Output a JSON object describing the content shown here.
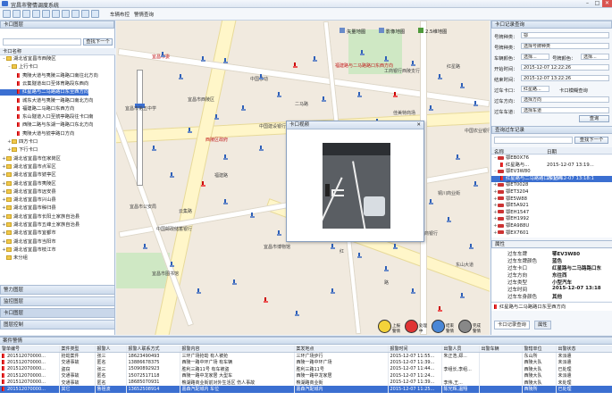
{
  "app": {
    "title": "宜昌市警情调度系统",
    "min": "–",
    "max": "□",
    "close": "✕"
  },
  "toolbar": {
    "vehicle_search": "车辆布控",
    "alarm_query": "警情查询"
  },
  "left_panel": {
    "title": "卡口图层",
    "search_label": "查找下一个",
    "col_header": "卡口名称",
    "tree": [
      {
        "t": "湖北省宜昌市西陵区",
        "lvl": 0,
        "k": "fold",
        "tog": "–"
      },
      {
        "t": "上行卡口",
        "lvl": 1,
        "k": "fold",
        "tog": "–"
      },
      {
        "t": "夷陵大道与夷陵三路路口南往北方向",
        "lvl": 2,
        "k": "flag"
      },
      {
        "t": "云集隧道出口至体育路段东西向",
        "lvl": 2,
        "k": "flag"
      },
      {
        "t": "红星路与二马路路口东至西方向",
        "lvl": 2,
        "k": "flag",
        "sel": true
      },
      {
        "t": "城东大道与夷陵一路路口南北方向",
        "lvl": 2,
        "k": "flag"
      },
      {
        "t": "福建路二马路口东西方向",
        "lvl": 2,
        "k": "flag"
      },
      {
        "t": "东山隧道入口至猇亭路段往卡口南",
        "lvl": 2,
        "k": "flag"
      },
      {
        "t": "西陵二路与东湖一路路口东北方向",
        "lvl": 2,
        "k": "flag"
      },
      {
        "t": "夷陵大道与猇亭路口方向",
        "lvl": 2,
        "k": "flag"
      },
      {
        "t": "四方卡口",
        "lvl": 1,
        "k": "fold",
        "tog": "+"
      },
      {
        "t": "下行卡口",
        "lvl": 1,
        "k": "fold",
        "tog": "+"
      },
      {
        "t": "湖北省宜昌市伍家岗区",
        "lvl": 0,
        "k": "fold",
        "tog": "+"
      },
      {
        "t": "湖北省宜昌市点军区",
        "lvl": 0,
        "k": "fold",
        "tog": "+"
      },
      {
        "t": "湖北省宜昌市猇亭区",
        "lvl": 0,
        "k": "fold",
        "tog": "+"
      },
      {
        "t": "湖北省宜昌市夷陵区",
        "lvl": 0,
        "k": "fold",
        "tog": "+"
      },
      {
        "t": "湖北省宜昌市远安县",
        "lvl": 0,
        "k": "fold",
        "tog": "+"
      },
      {
        "t": "湖北省宜昌市兴山县",
        "lvl": 0,
        "k": "fold",
        "tog": "+"
      },
      {
        "t": "湖北省宜昌市秭归县",
        "lvl": 0,
        "k": "fold",
        "tog": "+"
      },
      {
        "t": "湖北省宜昌市长阳土家族自治县",
        "lvl": 0,
        "k": "fold",
        "tog": "+"
      },
      {
        "t": "湖北省宜昌市五峰土家族自治县",
        "lvl": 0,
        "k": "fold",
        "tog": "+"
      },
      {
        "t": "湖北省宜昌市宜都市",
        "lvl": 0,
        "k": "fold",
        "tog": "+"
      },
      {
        "t": "湖北省宜昌市当阳市",
        "lvl": 0,
        "k": "fold",
        "tog": "+"
      },
      {
        "t": "湖北省宜昌市枝江市",
        "lvl": 0,
        "k": "fold",
        "tog": "+"
      },
      {
        "t": "未分组",
        "lvl": 0,
        "k": "fold",
        "tog": ""
      }
    ],
    "tabs": [
      "警力图层",
      "监控图层",
      "卡口图层",
      "图层控制"
    ]
  },
  "map": {
    "modes": [
      "矢量地图",
      "影像地图",
      "2.5维地图"
    ],
    "labels": [
      {
        "t": "宜昌市委",
        "red": true
      },
      {
        "t": "福建路与二马路路口东西方向",
        "red": true
      },
      {
        "t": "红星路与二马路路口东至西方向",
        "red": true
      },
      {
        "t": "西陵区政府",
        "red": true
      },
      {
        "t": "中国移动",
        "red": false
      },
      {
        "t": "工商银行西陵支行",
        "red": false
      },
      {
        "t": "宜昌市西陵区",
        "red": false
      },
      {
        "t": "宜昌市第五中学",
        "red": false
      },
      {
        "t": "佳美特商场",
        "red": false
      },
      {
        "t": "中国建设银行宜昌分行",
        "red": false
      },
      {
        "t": "红星路",
        "red": false
      },
      {
        "t": "宜昌市博物馆",
        "red": false
      },
      {
        "t": "云集路",
        "red": false
      },
      {
        "t": "中国邮政储蓄银行",
        "red": false
      },
      {
        "t": "红",
        "red": false
      },
      {
        "t": "路",
        "red": false
      },
      {
        "t": "东山中学",
        "red": false
      },
      {
        "t": "夷陵路",
        "red": false
      },
      {
        "t": "铜川商业街",
        "red": false
      },
      {
        "t": "城东公园",
        "red": false
      },
      {
        "t": "中国农业银行",
        "red": false
      },
      {
        "t": "宜昌市公安局",
        "red": false
      },
      {
        "t": "福建路",
        "red": false
      },
      {
        "t": "二马路",
        "red": false
      },
      {
        "t": "工商银行",
        "red": false
      },
      {
        "t": "宜昌市图书馆",
        "red": false
      },
      {
        "t": "东山大道",
        "red": false
      }
    ],
    "legend": [
      {
        "t": "上报 警情",
        "c": "#f3d23a"
      },
      {
        "t": "处理 中",
        "c": "#e03434"
      },
      {
        "t": "结束 警情",
        "c": "#4a87d6"
      },
      {
        "t": "完成 警情",
        "c": "#888888"
      }
    ],
    "dialog_title": "卡口视频",
    "dialog_close": "✕"
  },
  "right_panel": {
    "title": "卡口记录查询",
    "form": [
      {
        "l": "号牌种类：",
        "v": "鄂"
      },
      {
        "l": "号牌种类：",
        "v": "选择号牌种类"
      },
      {
        "l": "车辆颜色：",
        "v": "选择...",
        "l2": "号牌颜色：",
        "v2": "选择..."
      },
      {
        "l": "开始时间：",
        "v": "2015-12-07 12:22:26"
      },
      {
        "l": "结束时间：",
        "v": "2015-12-07 13:22:26"
      },
      {
        "l": "过车卡口：",
        "v": "红星路...",
        "l2": "卡口模糊查询"
      },
      {
        "l": "过车方向：",
        "v": "选择方向"
      },
      {
        "l": "过车车道：",
        "v": "选择车道"
      }
    ],
    "search_btn": "查询",
    "result_title": "查询过车记录",
    "find_next": "查找下一个",
    "cols": [
      "名称",
      "日期"
    ],
    "records": [
      {
        "t": "鄂EB0X76",
        "lvl": 0,
        "tog": "–"
      },
      {
        "t": "红星路与...",
        "lvl": 1,
        "date": "2015-12-07 13:19..."
      },
      {
        "t": "鄂EV3W80",
        "lvl": 0,
        "tog": "–"
      },
      {
        "t": "红星路与二马路路口东至西",
        "lvl": 1,
        "date": "2015-12-07 13:18:1",
        "sel": true
      },
      {
        "t": "鄂ET0028",
        "lvl": 0,
        "tog": "+"
      },
      {
        "t": "鄂ET3204",
        "lvl": 0,
        "tog": "+"
      },
      {
        "t": "鄂E5W88",
        "lvl": 0,
        "tog": "+"
      },
      {
        "t": "鄂E5A921",
        "lvl": 0,
        "tog": "+"
      },
      {
        "t": "鄂EH1547",
        "lvl": 0,
        "tog": "+"
      },
      {
        "t": "鄂EH1992",
        "lvl": 0,
        "tog": "+"
      },
      {
        "t": "鄂EA988U",
        "lvl": 0,
        "tog": "+"
      },
      {
        "t": "鄂EX7601",
        "lvl": 0,
        "tog": "+"
      }
    ],
    "props_title": "属性",
    "props": [
      {
        "k": "过车车牌",
        "v": "鄂EV3W80"
      },
      {
        "k": "过车车牌颜色",
        "v": "蓝色"
      },
      {
        "k": "过车卡口",
        "v": "红星路与二马路路口东"
      },
      {
        "k": "过车方向",
        "v": "东往西"
      },
      {
        "k": "过车类型",
        "v": "小型汽车"
      },
      {
        "k": "过车时间",
        "v": "2015-12-07 13:18"
      },
      {
        "k": "过车车身颜色",
        "v": "其他"
      }
    ],
    "bottom_item": "红星路与二马路路口东至西方向",
    "tabs": [
      "卡口记录查询",
      "属性"
    ]
  },
  "alarm": {
    "title": "案件警情",
    "headers": [
      "警单编号",
      "案件类型",
      "报警人",
      "报警人联系方式",
      "报警内容",
      "案发地点",
      "报警时间",
      "出警人员",
      "出警车辆",
      "警辖单位",
      "出警状态"
    ],
    "rows": [
      [
        "201512070000...",
        "抢劫案件",
        "张三",
        "18623490493",
        "三环广场抢劫 有人被抢",
        "三环广场步行",
        "2015-12-07 11:55...",
        "朱正浩,郑...",
        "",
        "东山所",
        "未派遣"
      ],
      [
        "201512070000...",
        "交通事故",
        "匿名",
        "13886678375",
        "西陵一路中环广场 有车辆",
        "西陵一路中环广场",
        "2015-12-07 11:39...",
        "",
        "",
        "西陵大队",
        "未派遣"
      ],
      [
        "201512070000...",
        "盗窃",
        "张三",
        "15090892923",
        "胜利三路11号 有车被盗",
        "胜利三路11号",
        "2015-12-07 11:44...",
        "李组长,李组...",
        "",
        "西陵大队",
        "已处理"
      ],
      [
        "201512070000...",
        "交通事故",
        "匿名",
        "15072517118",
        "西陵一路中龙家居 大型车",
        "西陵一路中龙家居",
        "2015-12-07 11:24...",
        "",
        "",
        "西陵大队",
        "未派遣"
      ],
      [
        "201512070000...",
        "交通事故",
        "匿名",
        "18685070931",
        "樵湖路商业街前对外生活区 伤人事故",
        "樵湖路商业街",
        "2015-12-07 11:39...",
        "李伟,王...",
        "",
        "西陵大队",
        "未处理"
      ],
      [
        "201512070000...",
        "其它",
        "鲁祖波",
        "13652508914",
        "嘉森汽配城内 车位",
        "嘉森汽配城内",
        "2015-12-07 11:25...",
        "陈光辉,温翔",
        "",
        "西陵所",
        "已处理"
      ]
    ]
  },
  "colors": {
    "accent": "#3b6fd1",
    "panel": "#dfe8f3",
    "map_bg": "#f1eadf",
    "road": "#fff6c9"
  }
}
